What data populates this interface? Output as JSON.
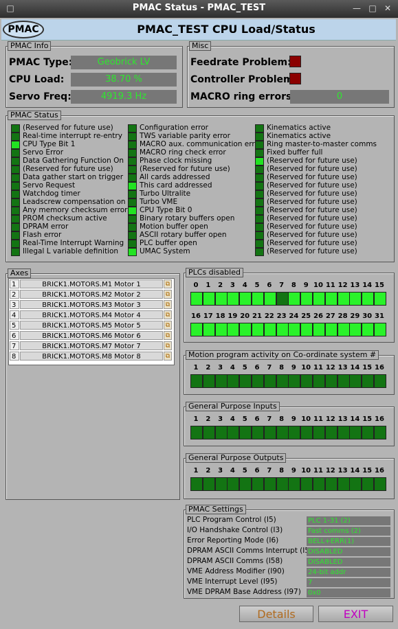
{
  "window": {
    "title": "PMAC Status - PMAC_TEST"
  },
  "header": {
    "logo": "PMAC",
    "title": "PMAC_TEST CPU Load/Status"
  },
  "pmac_info": {
    "label": "PMAC Info",
    "type_label": "PMAC Type:",
    "type_value": "Geobrick LV",
    "cpu_label": "CPU Load:",
    "cpu_value": "38.70 %",
    "servo_label": "Servo Freq:",
    "servo_value": "4919.3 Hz"
  },
  "misc": {
    "label": "Misc",
    "feedrate_label": "Feedrate Problem:",
    "controller_label": "Controller Problem:",
    "macro_label": "MACRO ring errors:",
    "macro_value": "0"
  },
  "pmac_status": {
    "label": "PMAC Status",
    "col1": [
      {
        "text": "(Reserved for future use)",
        "on": false
      },
      {
        "text": "Real-time interrupt re-entry",
        "on": false
      },
      {
        "text": "CPU Type Bit 1",
        "on": true
      },
      {
        "text": "Servo Error",
        "on": false
      },
      {
        "text": "Data Gathering Function On",
        "on": false
      },
      {
        "text": "(Reserved for future use)",
        "on": false
      },
      {
        "text": "Data gather start on trigger",
        "on": false
      },
      {
        "text": "Servo Request",
        "on": false
      },
      {
        "text": "Watchdog timer",
        "on": false
      },
      {
        "text": "Leadscrew compensation on",
        "on": false
      },
      {
        "text": "Any memory checksum error",
        "on": false
      },
      {
        "text": "PROM checksum active",
        "on": false
      },
      {
        "text": "DPRAM error",
        "on": false
      },
      {
        "text": "Flash error",
        "on": false
      },
      {
        "text": "Real-Time Interrupt Warning",
        "on": false
      },
      {
        "text": "Illegal L variable definition",
        "on": false
      }
    ],
    "col2": [
      {
        "text": "Configuration error",
        "on": false
      },
      {
        "text": "TWS variable parity error",
        "on": false
      },
      {
        "text": "MACRO aux. communication error",
        "on": false
      },
      {
        "text": "MACRO ring check error",
        "on": false
      },
      {
        "text": "Phase clock missing",
        "on": false
      },
      {
        "text": "(Reserved for future use)",
        "on": false
      },
      {
        "text": "All cards addressed",
        "on": false
      },
      {
        "text": "This card addressed",
        "on": true
      },
      {
        "text": "Turbo Ultralite",
        "on": false
      },
      {
        "text": "Turbo VME",
        "on": false
      },
      {
        "text": "CPU Type Bit 0",
        "on": true
      },
      {
        "text": "Binary rotary buffers open",
        "on": false
      },
      {
        "text": "Motion buffer open",
        "on": false
      },
      {
        "text": "ASCII rotary buffer open",
        "on": false
      },
      {
        "text": "PLC buffer open",
        "on": false
      },
      {
        "text": "UMAC System",
        "on": true
      }
    ],
    "col3": [
      {
        "text": "Kinematics active",
        "on": false
      },
      {
        "text": "Kinematics active",
        "on": false
      },
      {
        "text": "Ring master-to-master comms",
        "on": false
      },
      {
        "text": "Fixed buffer full",
        "on": false
      },
      {
        "text": "(Reserved for future use)",
        "on": true
      },
      {
        "text": "(Reserved for future use)",
        "on": false
      },
      {
        "text": "(Reserved for future use)",
        "on": false
      },
      {
        "text": "(Reserved for future use)",
        "on": false
      },
      {
        "text": "(Reserved for future use)",
        "on": false
      },
      {
        "text": "(Reserved for future use)",
        "on": false
      },
      {
        "text": "(Reserved for future use)",
        "on": false
      },
      {
        "text": "(Reserved for future use)",
        "on": false
      },
      {
        "text": "(Reserved for future use)",
        "on": false
      },
      {
        "text": "(Reserved for future use)",
        "on": false
      },
      {
        "text": "(Reserved for future use)",
        "on": false
      },
      {
        "text": "(Reserved for future use)",
        "on": false
      }
    ]
  },
  "axes": {
    "label": "Axes",
    "rows": [
      {
        "n": "1",
        "name": "BRICK1.MOTORS.M1 Motor 1"
      },
      {
        "n": "2",
        "name": "BRICK1.MOTORS.M2 Motor 2"
      },
      {
        "n": "3",
        "name": "BRICK1.MOTORS.M3 Motor 3"
      },
      {
        "n": "4",
        "name": "BRICK1.MOTORS.M4 Motor 4"
      },
      {
        "n": "5",
        "name": "BRICK1.MOTORS.M5 Motor 5"
      },
      {
        "n": "6",
        "name": "BRICK1.MOTORS.M6 Motor 6"
      },
      {
        "n": "7",
        "name": "BRICK1.MOTORS.M7 Motor 7"
      },
      {
        "n": "8",
        "name": "BRICK1.MOTORS.M8 Motor 8"
      }
    ]
  },
  "plcs": {
    "label": "PLCs disabled",
    "nums1": [
      "0",
      "1",
      "2",
      "3",
      "4",
      "5",
      "6",
      "7",
      "8",
      "9",
      "10",
      "11",
      "12",
      "13",
      "14",
      "15"
    ],
    "on1": [
      1,
      1,
      1,
      1,
      1,
      1,
      1,
      0,
      1,
      1,
      1,
      1,
      1,
      1,
      1,
      1
    ],
    "nums2": [
      "16",
      "17",
      "18",
      "19",
      "20",
      "21",
      "22",
      "23",
      "24",
      "25",
      "26",
      "27",
      "28",
      "29",
      "30",
      "31"
    ],
    "on2": [
      1,
      1,
      1,
      1,
      1,
      1,
      1,
      1,
      1,
      1,
      1,
      1,
      1,
      1,
      1,
      1
    ]
  },
  "motion": {
    "label": "Motion program activity on Co-ordinate system #",
    "nums": [
      "1",
      "2",
      "3",
      "4",
      "5",
      "6",
      "7",
      "8",
      "9",
      "10",
      "11",
      "12",
      "13",
      "14",
      "15",
      "16"
    ],
    "on": [
      0,
      0,
      0,
      0,
      0,
      0,
      0,
      0,
      0,
      0,
      0,
      0,
      0,
      0,
      0,
      0
    ]
  },
  "gpi": {
    "label": "General Purpose Inputs",
    "nums": [
      "1",
      "2",
      "3",
      "4",
      "5",
      "6",
      "7",
      "8",
      "9",
      "10",
      "11",
      "12",
      "13",
      "14",
      "15",
      "16"
    ],
    "on": [
      0,
      0,
      0,
      0,
      0,
      0,
      0,
      0,
      0,
      0,
      0,
      0,
      0,
      0,
      0,
      0
    ]
  },
  "gpo": {
    "label": "General Purpose Outputs",
    "nums": [
      "1",
      "2",
      "3",
      "4",
      "5",
      "6",
      "7",
      "8",
      "9",
      "10",
      "11",
      "12",
      "13",
      "14",
      "15",
      "16"
    ],
    "on": [
      0,
      0,
      0,
      0,
      0,
      0,
      0,
      0,
      0,
      0,
      0,
      0,
      0,
      0,
      0,
      0
    ]
  },
  "settings": {
    "label": "PMAC Settings",
    "rows": [
      {
        "label": "PLC Program Control (I5)",
        "value": "PLC 1-31 (2)"
      },
      {
        "label": "I/O Handshake Control (I3)",
        "value": "Fast comms (2)"
      },
      {
        "label": "Error Reporting Mode (I6)",
        "value": "BELL+ERR(1)"
      },
      {
        "label": "DPRAM ASCII Comms Interrupt (I56)",
        "value": "DISABLED"
      },
      {
        "label": "DPRAM ASCII Comms (I58)",
        "value": "DISABLED"
      },
      {
        "label": "VME Address Modifier (I90)",
        "value": "24-bit addr"
      },
      {
        "label": "VME Interrupt Level (I95)",
        "value": "7"
      },
      {
        "label": "VME DPRAM Base Address (I97)",
        "value": "0x0"
      }
    ]
  },
  "buttons": {
    "details": "Details",
    "exit": "EXIT"
  },
  "colors": {
    "led_on": "#2af22a",
    "led_off": "#137413",
    "value_text": "#2ee82e",
    "alarm": "#8b0000",
    "exit": "#c000c0",
    "details": "#b06a1e"
  }
}
